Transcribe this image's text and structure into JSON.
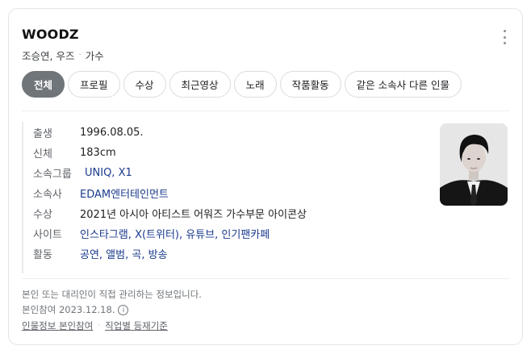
{
  "header": {
    "title": "WOODZ",
    "subtitle_names": "조승연, 우즈",
    "subtitle_role": "가수"
  },
  "tabs": [
    {
      "label": "전체",
      "active": true
    },
    {
      "label": "프로필",
      "active": false
    },
    {
      "label": "수상",
      "active": false
    },
    {
      "label": "최근영상",
      "active": false
    },
    {
      "label": "노래",
      "active": false
    },
    {
      "label": "작품활동",
      "active": false
    },
    {
      "label": "같은 소속사 다른 인물",
      "active": false
    }
  ],
  "info": {
    "birth": {
      "label": "출생",
      "value": "1996.08.05."
    },
    "height": {
      "label": "신체",
      "value": "183cm"
    },
    "group": {
      "label": "소속그룹",
      "value": "UNIQ, X1"
    },
    "agency": {
      "label": "소속사",
      "value": "EDAM엔터테인먼트"
    },
    "award": {
      "label": "수상",
      "value": "2021년 아시아 아티스트 어워즈 가수부문 아이콘상"
    },
    "site": {
      "label": "사이트",
      "value": "인스타그램, X(트위터), 유튜브, 인기팬카페"
    },
    "activity": {
      "label": "활동",
      "value": "공연, 앨범, 곡, 방송"
    }
  },
  "footer": {
    "notice": "본인 또는 대리인이 직접 관리하는 정보입니다.",
    "participation": "본인참여 2023.12.18.",
    "link_profile": "인물정보 본인참여",
    "link_criteria": "직업별 등재기준"
  }
}
